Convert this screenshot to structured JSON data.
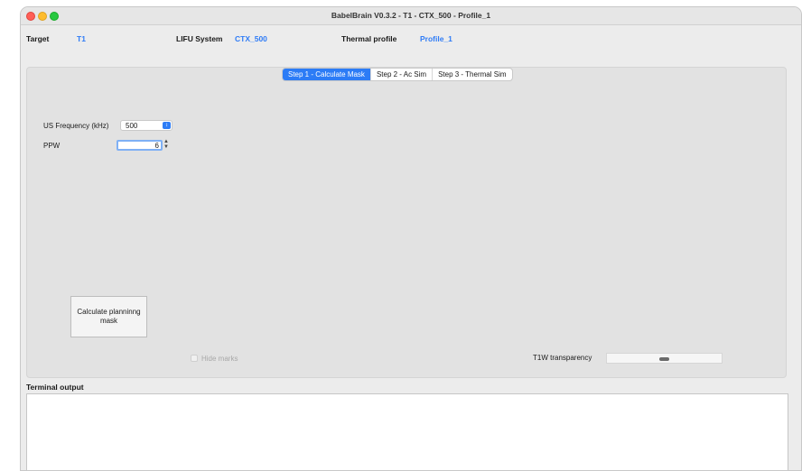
{
  "window": {
    "title": "BabelBrain V0.3.2 - T1 - CTX_500 - Profile_1"
  },
  "info": {
    "target_label": "Target",
    "target_value": "T1",
    "lifu_label": "LIFU System",
    "lifu_value": "CTX_500",
    "thermal_label": "Thermal profile",
    "thermal_value": "Profile_1"
  },
  "tabs": [
    {
      "label": "Step 1 - Calculate Mask",
      "active": true
    },
    {
      "label": "Step 2 - Ac Sim",
      "active": false
    },
    {
      "label": "Step 3 - Thermal Sim",
      "active": false
    }
  ],
  "form": {
    "frequency_label": "US Frequency (kHz)",
    "frequency_value": "500",
    "ppw_label": "PPW",
    "ppw_value": "6"
  },
  "calculate_button": "Calculate planninng mask",
  "hide_marks": {
    "label": "Hide marks",
    "checked": false
  },
  "transparency": {
    "label": "T1W transparency",
    "level": 0.5
  },
  "terminal": {
    "label": "Terminal output",
    "content": ""
  },
  "colors": {
    "accent": "#2c7cf6",
    "link_text": "#2f7cf6"
  },
  "icons": {
    "select_arrow": "chevron-updown-icon",
    "spin_arrows": "spin-arrows-icon"
  }
}
